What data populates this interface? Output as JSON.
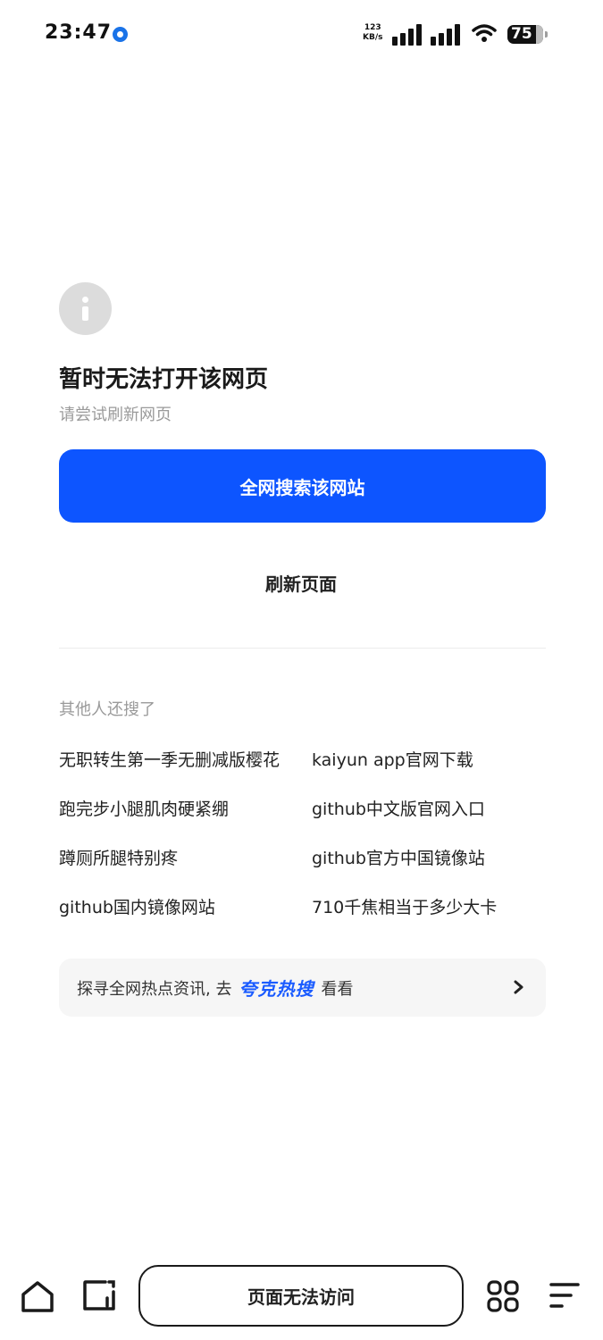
{
  "status_bar": {
    "time": "23:47",
    "net_speed_value": "123",
    "net_speed_unit": "KB/s",
    "battery_level": "75"
  },
  "error": {
    "title": "暂时无法打开该网页",
    "subtitle": "请尝试刷新网页"
  },
  "actions": {
    "search_site_label": "全网搜索该网站",
    "refresh_label": "刷新页面"
  },
  "suggestions": {
    "label": "其他人还搜了",
    "items": [
      "无职转生第一季无删减版樱花",
      "kaiyun app官网下载",
      "跑完步小腿肌肉硬紧绷",
      "github中文版官网入口",
      "蹲厕所腿特别疼",
      "github官方中国镜像站",
      "github国内镜像网站",
      "710千焦相当于多少大卡"
    ]
  },
  "hot_banner": {
    "prefix": "探寻全网热点资讯, 去",
    "brand": "夸克热搜",
    "suffix": "看看"
  },
  "bottom_bar": {
    "address_text": "页面无法访问"
  },
  "colors": {
    "accent": "#0d55ff",
    "brand_text": "#1a5bff"
  }
}
